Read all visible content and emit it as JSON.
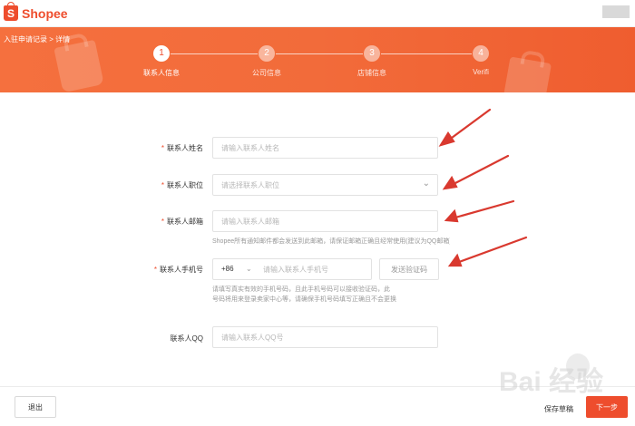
{
  "app": {
    "logo_glyph": "S",
    "logo_text": "Shopee"
  },
  "breadcrumb": "入驻申请记录 > 详情",
  "steps": [
    {
      "num": "1",
      "label": "联系人信息",
      "active": true
    },
    {
      "num": "2",
      "label": "公司信息",
      "active": false
    },
    {
      "num": "3",
      "label": "店铺信息",
      "active": false
    },
    {
      "num": "4",
      "label": "Verifi",
      "active": false
    }
  ],
  "form": {
    "name": {
      "label": "联系人姓名",
      "placeholder": "请输入联系人姓名",
      "required": true
    },
    "position": {
      "label": "联系人职位",
      "placeholder": "请选择联系人职位",
      "required": true
    },
    "email": {
      "label": "联系人邮箱",
      "placeholder": "请输入联系人邮箱",
      "required": true,
      "hint": "Shopee所有通知邮件都会发送到此邮箱，请保证邮箱正确且经常使用(建议为QQ邮箱)"
    },
    "phone": {
      "label": "联系人手机号",
      "country_code": "+86",
      "placeholder": "请输入联系人手机号",
      "required": true,
      "send_code": "发送验证码",
      "hint_line1": "请填写真实有效的手机号码，且此手机号码可以接收验证码，此",
      "hint_line2": "号码将用来登录卖家中心等，请确保手机号码填写正确且不会更换"
    },
    "qq": {
      "label": "联系人QQ",
      "placeholder": "请输入联系人QQ号",
      "required": false
    }
  },
  "footer": {
    "back": "退出",
    "save": "保存草稿",
    "next": "下一步"
  },
  "watermark": "Bai 经验",
  "colors": {
    "brand": "#ee4d2d",
    "banner": "#f26b3a",
    "arrow": "#d9392f"
  },
  "icons": {
    "logo": "shopee-bag-icon",
    "caret": "chevron-down-icon",
    "arrow": "red-arrow-annotation"
  }
}
